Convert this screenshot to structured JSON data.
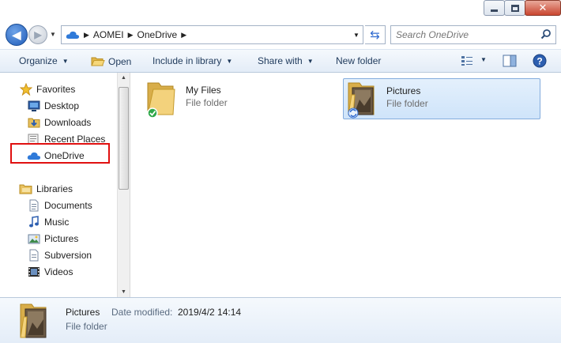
{
  "window": {
    "controls": {
      "minimize": "minimize",
      "maximize": "maximize",
      "close": "close"
    }
  },
  "address": {
    "crumbs": [
      "AOMEI",
      "OneDrive"
    ],
    "search_placeholder": "Search OneDrive"
  },
  "toolbar": {
    "organize": "Organize",
    "open": "Open",
    "include_in_library": "Include in library",
    "share_with": "Share with",
    "new_folder": "New folder"
  },
  "nav": {
    "favorites": {
      "label": "Favorites",
      "items": [
        "Desktop",
        "Downloads",
        "Recent Places",
        "OneDrive"
      ]
    },
    "libraries": {
      "label": "Libraries",
      "items": [
        "Documents",
        "Music",
        "Pictures",
        "Subversion",
        "Videos"
      ]
    },
    "highlight_color": "#e01010"
  },
  "content": {
    "items": [
      {
        "name": "My Files",
        "type": "File folder",
        "status": "synced"
      },
      {
        "name": "Pictures",
        "type": "File folder",
        "status": "syncing",
        "selected": true
      }
    ]
  },
  "details": {
    "name": "Pictures",
    "modified_label": "Date modified:",
    "modified": "2019/4/2 14:14",
    "type": "File folder"
  },
  "colors": {
    "accent": "#2f6ad0",
    "selection": "#cfe4fa",
    "toolbar_text": "#1e395b"
  }
}
